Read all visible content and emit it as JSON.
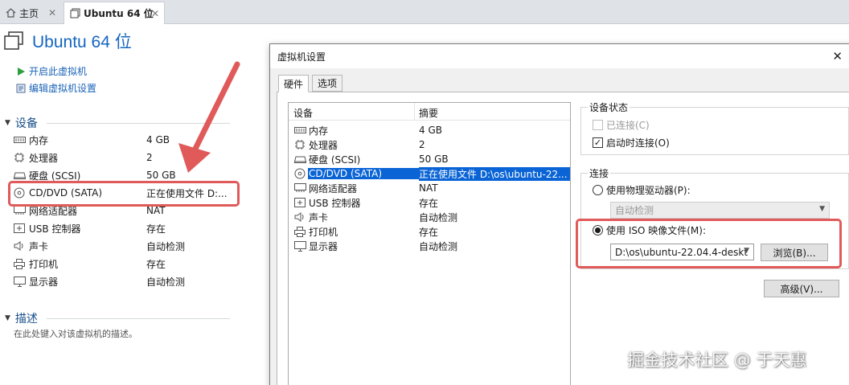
{
  "tabs": [
    {
      "label": "主页",
      "icon": "home-icon"
    },
    {
      "label": "Ubuntu 64 位",
      "icon": "vm-icon"
    }
  ],
  "vm": {
    "title": "Ubuntu 64 位",
    "actions": {
      "power_on": "开启此虚拟机",
      "edit_settings": "编辑虚拟机设置"
    },
    "devices_header": "设备",
    "devices": [
      {
        "name": "内存",
        "value": "4 GB",
        "icon": "memory-icon"
      },
      {
        "name": "处理器",
        "value": "2",
        "icon": "cpu-icon"
      },
      {
        "name": "硬盘 (SCSI)",
        "value": "50 GB",
        "icon": "harddisk-icon"
      },
      {
        "name": "CD/DVD (SATA)",
        "value": "正在使用文件 D:...",
        "icon": "cdrom-icon"
      },
      {
        "name": "网络适配器",
        "value": "NAT",
        "icon": "network-icon"
      },
      {
        "name": "USB 控制器",
        "value": "存在",
        "icon": "usb-icon"
      },
      {
        "name": "声卡",
        "value": "自动检测",
        "icon": "sound-icon"
      },
      {
        "name": "打印机",
        "value": "存在",
        "icon": "printer-icon"
      },
      {
        "name": "显示器",
        "value": "自动检测",
        "icon": "display-icon"
      }
    ],
    "description_header": "描述",
    "description_placeholder": "在此处键入对该虚拟机的描述。"
  },
  "dialog": {
    "title": "虚拟机设置",
    "tabs": [
      "硬件",
      "选项"
    ],
    "list_headers": {
      "device": "设备",
      "summary": "摘要"
    },
    "hardware": [
      {
        "name": "内存",
        "value": "4 GB",
        "icon": "memory-icon"
      },
      {
        "name": "处理器",
        "value": "2",
        "icon": "cpu-icon"
      },
      {
        "name": "硬盘 (SCSI)",
        "value": "50 GB",
        "icon": "harddisk-icon"
      },
      {
        "name": "CD/DVD (SATA)",
        "value": "正在使用文件 D:\\os\\ubuntu-22...",
        "icon": "cdrom-icon",
        "selected": true
      },
      {
        "name": "网络适配器",
        "value": "NAT",
        "icon": "network-icon"
      },
      {
        "name": "USB 控制器",
        "value": "存在",
        "icon": "usb-icon"
      },
      {
        "name": "声卡",
        "value": "自动检测",
        "icon": "sound-icon"
      },
      {
        "name": "打印机",
        "value": "存在",
        "icon": "printer-icon"
      },
      {
        "name": "显示器",
        "value": "自动检测",
        "icon": "display-icon"
      }
    ],
    "device_status": {
      "title": "设备状态",
      "connected": "已连接(C)",
      "connected_checked": false,
      "connected_disabled": true,
      "connect_at_power_on": "启动时连接(O)",
      "connect_at_power_on_checked": true
    },
    "connection": {
      "title": "连接",
      "physical_drive": "使用物理驱动器(P):",
      "physical_drive_value": "自动检测",
      "iso_image": "使用 ISO 映像文件(M):",
      "iso_path": "D:\\os\\ubuntu-22.04.4-deskt",
      "browse": "浏览(B)...",
      "selected": "iso"
    },
    "advanced": "高级(V)..."
  },
  "watermark": "掘金技术社区 @ 于天惠",
  "colors": {
    "accent": "#1565c0",
    "selection": "#0a64d6",
    "highlight": "#e05a5a"
  }
}
